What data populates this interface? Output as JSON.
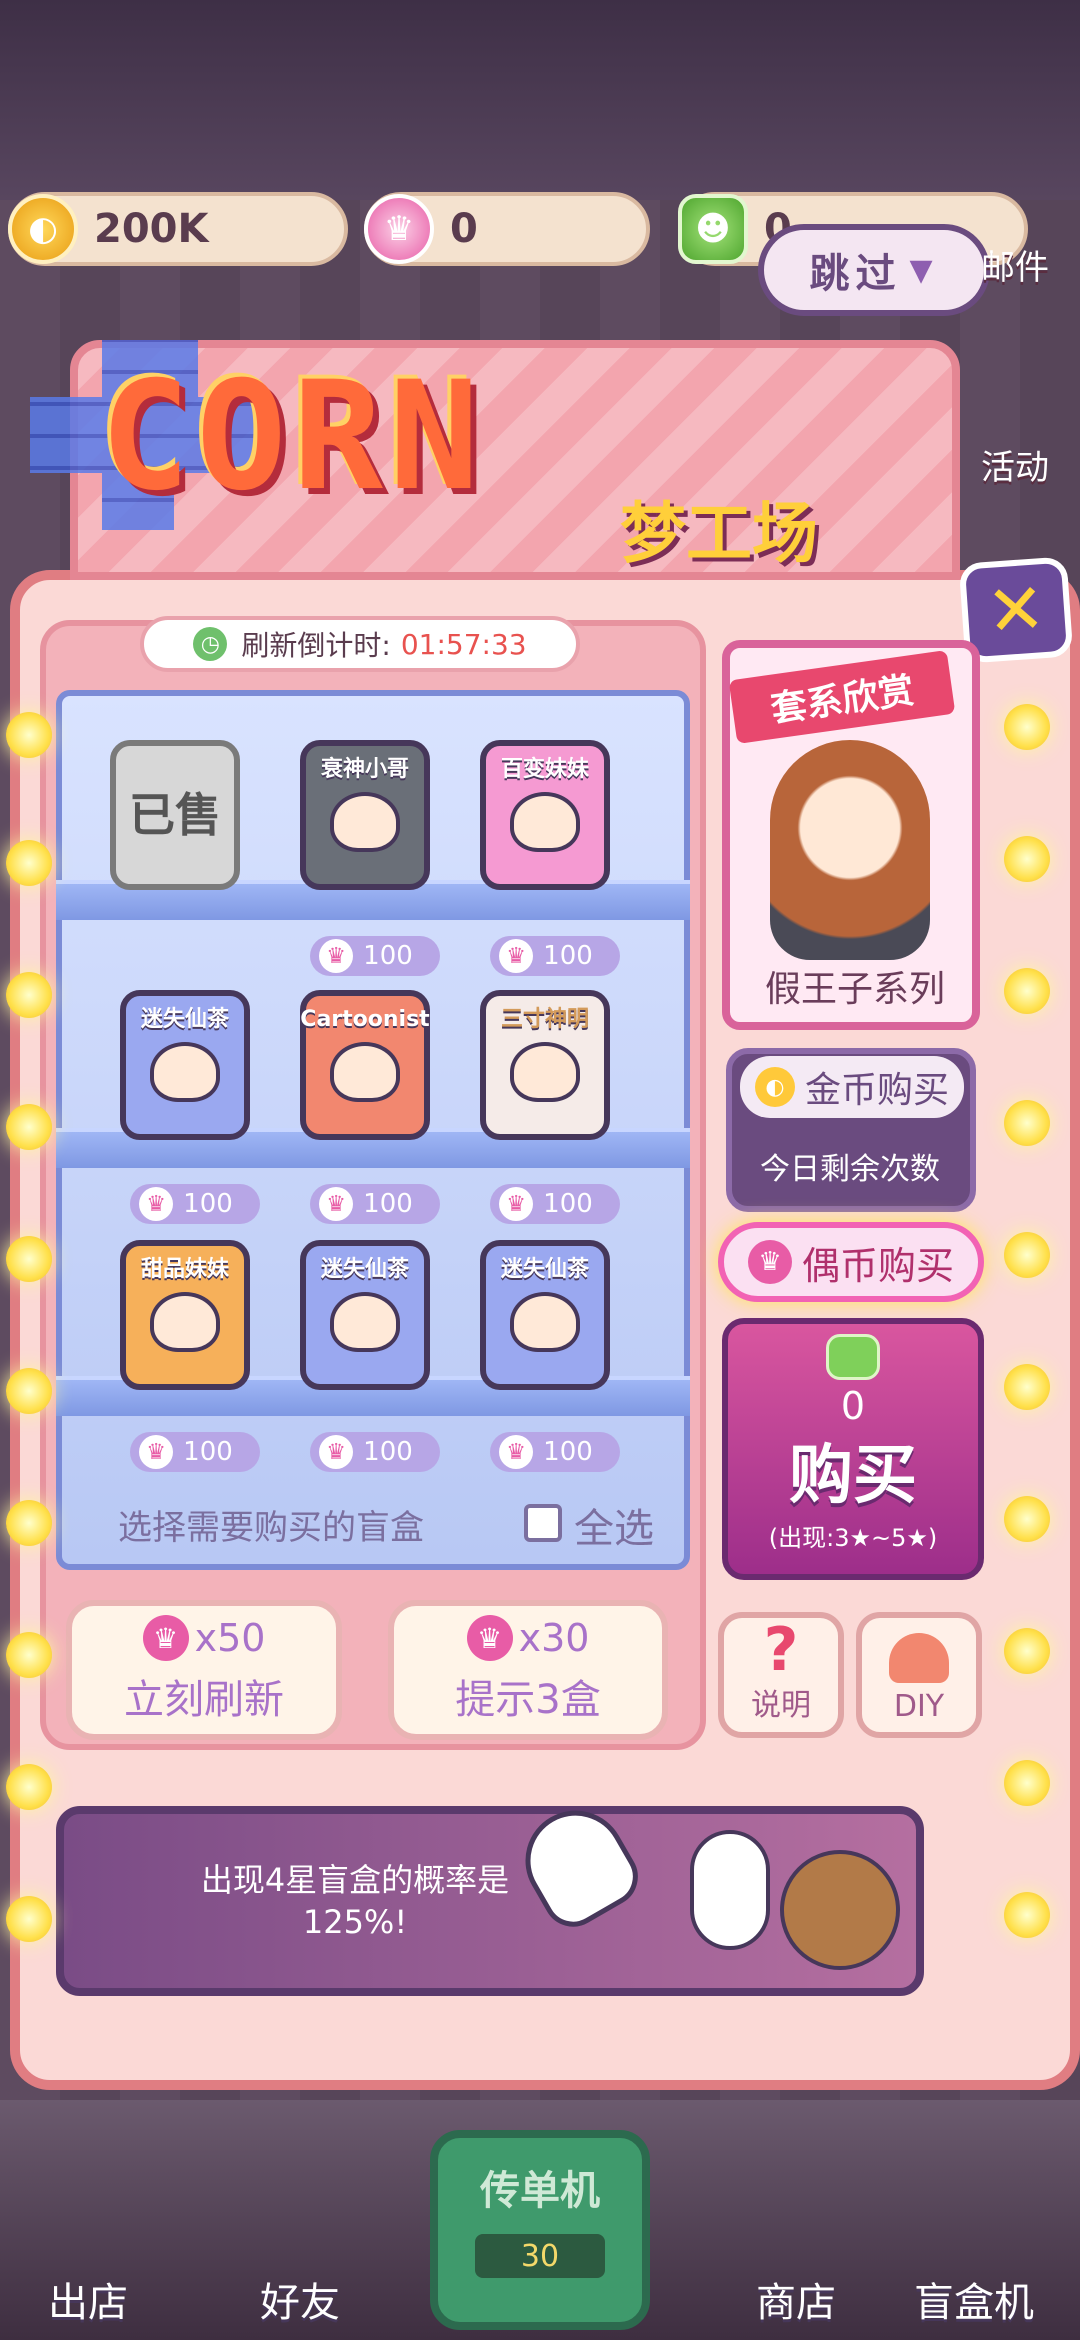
{
  "currency": {
    "gold": "200K",
    "idol_coins": "0",
    "gems": "0"
  },
  "skip_label": "跳过",
  "side": {
    "mail": "邮件",
    "activity": "活动"
  },
  "logo": {
    "title": "CORN",
    "subtitle": "梦工场"
  },
  "timer": {
    "label": "刷新倒计时:",
    "countdown": "01:57:33"
  },
  "shelf": {
    "rows": [
      [
        {
          "name": "已售",
          "style": "sold",
          "price": ""
        },
        {
          "name": "衰神小哥",
          "style": "dark",
          "price": "100"
        },
        {
          "name": "百变妹妹",
          "style": "pink",
          "price": "100"
        }
      ],
      [
        {
          "name": "迷失仙茶",
          "style": "blue",
          "price": "100"
        },
        {
          "name": "Cartoonist",
          "style": "coral",
          "price": "100"
        },
        {
          "name": "三寸神明",
          "style": "white",
          "price": "100"
        }
      ],
      [
        {
          "name": "甜品妹妹",
          "style": "orange",
          "price": "100"
        },
        {
          "name": "迷失仙茶",
          "style": "blue",
          "price": "100"
        },
        {
          "name": "迷失仙茶",
          "style": "blue",
          "price": "100"
        }
      ]
    ],
    "select_hint": "选择需要购买的盲盒",
    "select_all": "全选"
  },
  "actions": {
    "refresh": {
      "cost": "x50",
      "label": "立刻刷新"
    },
    "hint": {
      "cost": "x30",
      "label": "提示3盒"
    }
  },
  "series": {
    "tag": "套系欣赏",
    "name": "假王子系列"
  },
  "gold_buy": {
    "label": "金币购买",
    "remaining": "今日剩余次数"
  },
  "idol_buy": {
    "label": "偶币购买"
  },
  "buy": {
    "count": "0",
    "label": "购买",
    "odds": "(出现:3★~5★)"
  },
  "small_buttons": {
    "help": "说明",
    "diy": "DIY"
  },
  "tip": {
    "text": "出现4星盲盒的概率是125%!"
  },
  "nav": {
    "store_out": "出店",
    "friends": "好友",
    "flyer": "传单机",
    "flyer_count": "30",
    "shop": "商店",
    "blindbox": "盲盒机"
  }
}
